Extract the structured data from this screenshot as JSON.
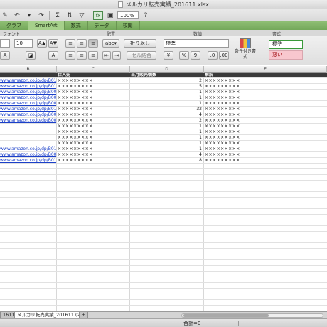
{
  "window": {
    "title": "メルカリ転売実績_201611.xlsx"
  },
  "toolbar": {
    "zoom": "100%",
    "fx": "fx"
  },
  "ribbon_tabs": [
    "グラフ",
    "SmartArt",
    "数式",
    "データ",
    "校閲"
  ],
  "groups": {
    "font": "フォント",
    "alignment": "配置",
    "number": "数値",
    "styles": "書式"
  },
  "ribbon": {
    "font_size": "10",
    "wrap_text": "折り返し",
    "merge_cells": "セル結合",
    "number_format": "標準",
    "percent": "%",
    "comma": "9",
    "conditional_format": "条件付き書式",
    "style_normal": "標準",
    "style_bad": "悪い"
  },
  "columns": [
    "B",
    "C",
    "D",
    "E"
  ],
  "table": {
    "headers": {
      "supplier": "仕入先",
      "sold": "当月販売個数",
      "notes": "解説"
    },
    "rows": [
      {
        "url": "www.amazon.co.jp/dp/B01MCUI",
        "supplier": "×××××××××",
        "sold": "2",
        "notes": "×××××××××"
      },
      {
        "url": "www.amazon.co.jp/dp/B0107PC",
        "supplier": "×××××××××",
        "sold": "5",
        "notes": "×××××××××"
      },
      {
        "url": "www.amazon.co.jp/dp/B00VHA",
        "supplier": "×××××××××",
        "sold": "1",
        "notes": "×××××××××"
      },
      {
        "url": "www.amazon.co.jp/dp/B00XZ2N",
        "supplier": "×××××××××",
        "sold": "1",
        "notes": "×××××××××"
      },
      {
        "url": "www.amazon.co.jp/dp/B004VC7",
        "supplier": "×××××××××",
        "sold": "1",
        "notes": "×××××××××"
      },
      {
        "url": "www.amazon.co.jp/dp/B0140RC",
        "supplier": "×××××××××",
        "sold": "32",
        "notes": "×××××××××"
      },
      {
        "url": "www.amazon.co.jp/dp/B0030ZO",
        "supplier": "×××××××××",
        "sold": "4",
        "notes": "×××××××××"
      },
      {
        "url": "www.amazon.co.jp/dp/B00A999",
        "supplier": "×××××××××",
        "sold": "2",
        "notes": "×××××××××"
      },
      {
        "url": "",
        "supplier": "×××××××××",
        "sold": "1",
        "notes": "×××××××××"
      },
      {
        "url": "",
        "supplier": "×××××××××",
        "sold": "1",
        "notes": "×××××××××"
      },
      {
        "url": "",
        "supplier": "×××××××××",
        "sold": "1",
        "notes": "×××××××××"
      },
      {
        "url": "",
        "supplier": "×××××××××",
        "sold": "1",
        "notes": "×××××××××"
      },
      {
        "url": "www.amazon.co.jp/dp/B010EQV",
        "supplier": "×××××××××",
        "sold": "1",
        "notes": "×××××××××"
      },
      {
        "url": "www.amazon.co.jp/dp/B001LGV",
        "supplier": "×××××××××",
        "sold": "4",
        "notes": "×××××××××"
      },
      {
        "url": "www.amazon.co.jp/dp/B013JDJ",
        "supplier": "×××××××××",
        "sold": "8",
        "notes": "×××××××××"
      }
    ]
  },
  "sheet_tabs": [
    "1611",
    "メルカリ転売実績_201611 (2)",
    "+"
  ],
  "status": {
    "sum": "合計=0"
  }
}
